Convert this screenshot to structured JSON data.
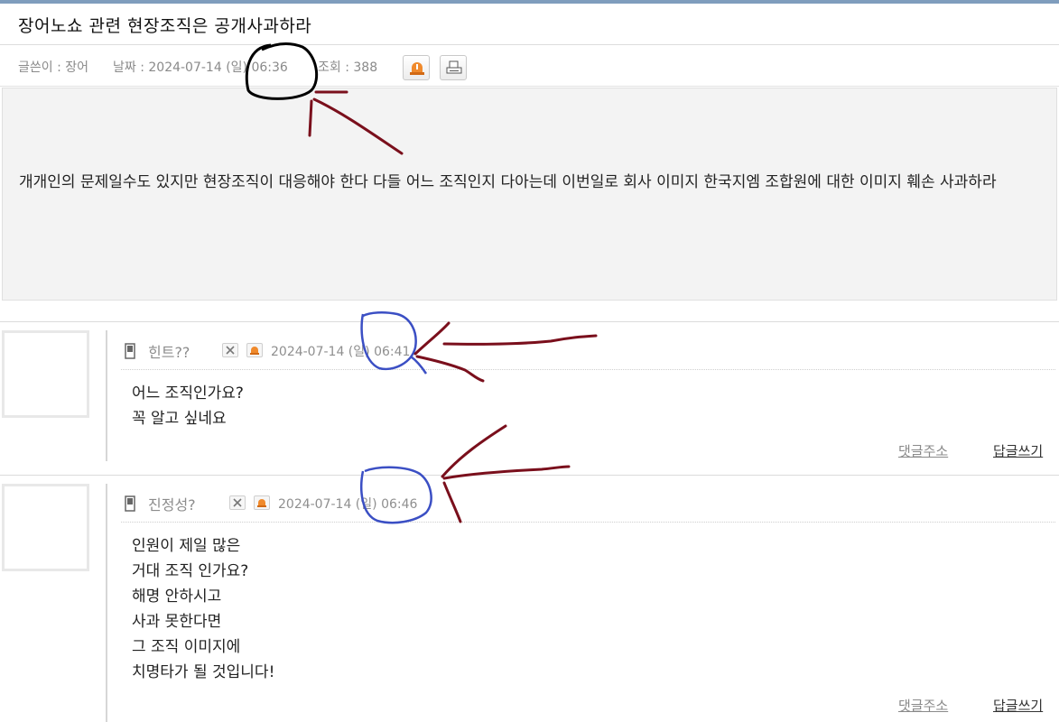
{
  "post": {
    "title": "장어노쇼 관련 현장조직은 공개사과하라",
    "author_label": "글쓴이 : 장어",
    "date_label": "날짜 : 2024-07-14 (일) 06:36",
    "views_label": "조회 : 388",
    "body": "개개인의 문제일수도 있지만 현장조직이 대응해야 한다 다들 어느 조직인지 다아는데 이번일로 회사 이미지 한국지엠 조합원에 대한 이미지 훼손 사과하라"
  },
  "icons": {
    "report": "alarm-bell-icon",
    "print": "printer-icon",
    "comment_type": "mobile-phone-icon",
    "delete": "close-icon"
  },
  "comments": [
    {
      "author": "힌트??",
      "date": "2024-07-14 (일) 06:41",
      "body": "어느 조직인가요?\n꼭 알고 싶네요",
      "link_address": "댓글주소",
      "link_reply": "답글쓰기"
    },
    {
      "author": "진정성?",
      "date": "2024-07-14 (일) 06:46",
      "body": "인원이 제일 많은\n거대 조직 인가요?\n해명 안하시고\n사과 못한다면\n그 조직 이미지에\n치명타가 될 것입니다!",
      "link_address": "댓글주소",
      "link_reply": "답글쓰기"
    }
  ],
  "colors": {
    "accent_border": "#7f9dbd",
    "report_orange": "#f08a2c",
    "annotation_black": "#000000",
    "annotation_blue": "#3b4fc4",
    "annotation_red": "#7a0f1c"
  }
}
